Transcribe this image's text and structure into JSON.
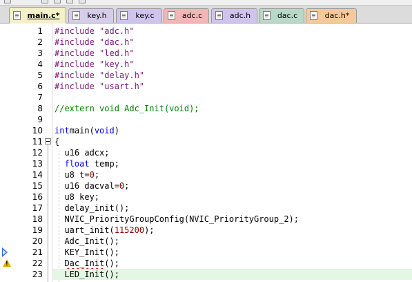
{
  "tabs": [
    {
      "label": "main.c*",
      "active": true,
      "color": "#f4f0c8"
    },
    {
      "label": "key.h",
      "active": false,
      "color": "#d6cdea"
    },
    {
      "label": "key.c",
      "active": false,
      "color": "#d0c4ee"
    },
    {
      "label": "adc.c",
      "active": false,
      "color": "#f2b6b6"
    },
    {
      "label": "adc.h",
      "active": false,
      "color": "#d0c4ee"
    },
    {
      "label": "dac.c",
      "active": false,
      "color": "#b8d8c8"
    },
    {
      "label": "dac.h*",
      "active": false,
      "color": "#f7c99a"
    }
  ],
  "editor": {
    "highlighted_line": "23",
    "lines": [
      {
        "num": "1",
        "tokens": [
          [
            "pp",
            "#include "
          ],
          [
            "str",
            "\"adc.h\""
          ]
        ]
      },
      {
        "num": "2",
        "tokens": [
          [
            "pp",
            "#include "
          ],
          [
            "str",
            "\"dac.h\""
          ]
        ]
      },
      {
        "num": "3",
        "tokens": [
          [
            "pp",
            "#include "
          ],
          [
            "str",
            "\"led.h\""
          ]
        ]
      },
      {
        "num": "4",
        "tokens": [
          [
            "pp",
            "#include "
          ],
          [
            "str",
            "\"key.h\""
          ]
        ]
      },
      {
        "num": "5",
        "tokens": [
          [
            "pp",
            "#include "
          ],
          [
            "str",
            "\"delay.h\""
          ]
        ]
      },
      {
        "num": "6",
        "tokens": [
          [
            "pp",
            "#include "
          ],
          [
            "str",
            "\"usart.h\""
          ]
        ]
      },
      {
        "num": "7",
        "tokens": []
      },
      {
        "num": "8",
        "tokens": [
          [
            "cm",
            "//extern void Adc_Init(void);"
          ]
        ]
      },
      {
        "num": "9",
        "tokens": []
      },
      {
        "num": "10",
        "tokens": [
          [
            "kw",
            "int"
          ],
          [
            "",
            "main("
          ],
          [
            "kw",
            "void"
          ],
          [
            "",
            ")"
          ]
        ]
      },
      {
        "num": "11",
        "tokens": [
          [
            "",
            "{"
          ]
        ]
      },
      {
        "num": "12",
        "tokens": [
          [
            "",
            "  u16 adcx;"
          ]
        ]
      },
      {
        "num": "13",
        "tokens": [
          [
            "",
            "  "
          ],
          [
            "kw",
            "float"
          ],
          [
            "",
            " temp;"
          ]
        ]
      },
      {
        "num": "14",
        "tokens": [
          [
            "",
            "  u8 t="
          ],
          [
            "num",
            "0"
          ],
          [
            "",
            ";"
          ]
        ]
      },
      {
        "num": "15",
        "tokens": [
          [
            "",
            "  u16 dacval="
          ],
          [
            "num",
            "0"
          ],
          [
            "",
            ";"
          ]
        ]
      },
      {
        "num": "16",
        "tokens": [
          [
            "",
            "  u8 key;"
          ]
        ]
      },
      {
        "num": "17",
        "tokens": [
          [
            "",
            "  delay_init();"
          ]
        ]
      },
      {
        "num": "18",
        "tokens": [
          [
            "",
            "  NVIC_PriorityGroupConfig(NVIC_PriorityGroup_2);"
          ]
        ]
      },
      {
        "num": "19",
        "tokens": [
          [
            "",
            "  uart_init("
          ],
          [
            "num",
            "115200"
          ],
          [
            "",
            ");"
          ]
        ]
      },
      {
        "num": "20",
        "tokens": [
          [
            "",
            "  Adc_Init();"
          ]
        ]
      },
      {
        "num": "21",
        "tokens": [
          [
            "",
            "  KEY_Init();"
          ]
        ]
      },
      {
        "num": "22",
        "tokens": [
          [
            "",
            "  "
          ],
          [
            "squiggle",
            "Dac_Init"
          ],
          [
            "",
            "();"
          ]
        ]
      },
      {
        "num": "23",
        "tokens": [
          [
            "",
            "  LED_Init();"
          ]
        ]
      }
    ]
  },
  "gutter_markers": [
    {
      "line": "21",
      "icon": "current-line-arrow-icon"
    },
    {
      "line": "22",
      "icon": "warning-icon",
      "glyph": "!"
    }
  ],
  "fold_marker": {
    "line": "11",
    "icon": "fold-collapse-icon"
  }
}
